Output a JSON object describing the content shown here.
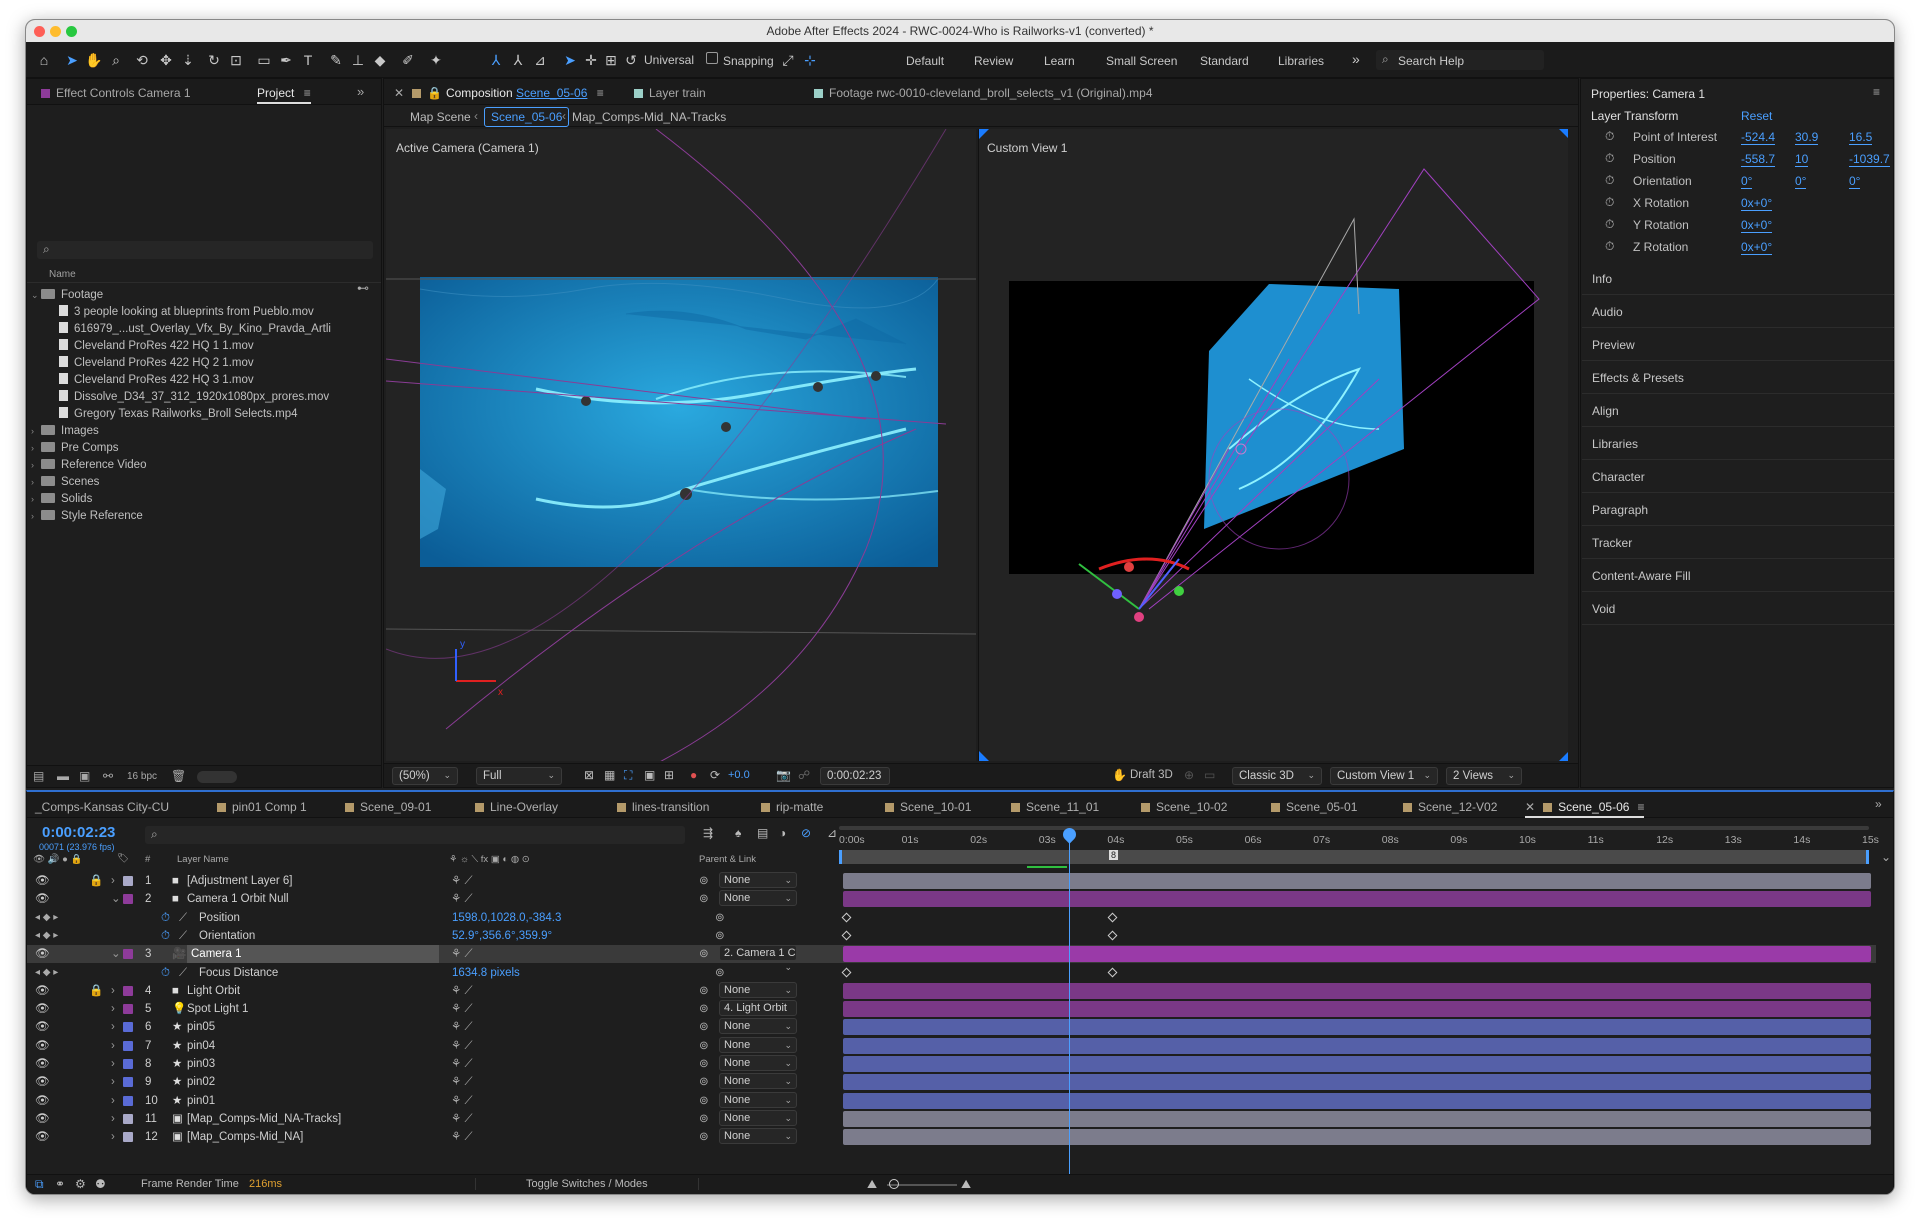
{
  "window": {
    "title": "Adobe After Effects 2024 - RWC-0024-Who is Railworks-v1 (converted) *"
  },
  "toolbar": {
    "universal_label": "Universal",
    "snapping_label": "Snapping",
    "workspaces": [
      "Default",
      "Review",
      "Learn",
      "Small Screen",
      "Standard",
      "Libraries"
    ],
    "search_placeholder": "Search Help"
  },
  "left_panel": {
    "tab_effect": "Effect Controls Camera 1",
    "tab_project": "Project",
    "name_header": "Name",
    "bpc": "16 bpc",
    "tree": [
      {
        "label": "Footage",
        "type": "folder",
        "open": true
      },
      {
        "label": "3 people looking at blueprints from Pueblo.mov",
        "type": "file"
      },
      {
        "label": "616979_...ust_Overlay_Vfx_By_Kino_Pravda_Artli",
        "type": "file"
      },
      {
        "label": "Cleveland ProRes 422 HQ 1 1.mov",
        "type": "file"
      },
      {
        "label": "Cleveland ProRes 422 HQ 2 1.mov",
        "type": "file"
      },
      {
        "label": "Cleveland ProRes 422 HQ 3 1.mov",
        "type": "file"
      },
      {
        "label": "Dissolve_D34_37_312_1920x1080px_prores.mov",
        "type": "file"
      },
      {
        "label": "Gregory Texas Railworks_Broll Selects.mp4",
        "type": "file"
      },
      {
        "label": "Images",
        "type": "folder"
      },
      {
        "label": "Pre Comps",
        "type": "folder"
      },
      {
        "label": "Reference Video",
        "type": "folder"
      },
      {
        "label": "Scenes",
        "type": "folder"
      },
      {
        "label": "Solids",
        "type": "folder"
      },
      {
        "label": "Style Reference",
        "type": "folder"
      }
    ]
  },
  "comp": {
    "tab_composition_prefix": "Composition",
    "tab_composition_name": "Scene_05-06",
    "tab_layer": "Layer train",
    "tab_footage": "Footage rwc-0010-cleveland_broll_selects_v1 (Original).mp4",
    "breadcrumbs": [
      "Map Scene",
      "Scene_05-06",
      "Map_Comps-Mid_NA-Tracks"
    ],
    "left_view_label": "Active Camera (Camera 1)",
    "right_view_label": "Custom View 1",
    "footer": {
      "zoom": "(50%)",
      "resolution": "Full",
      "exposure": "+0.0",
      "timecode": "0:00:02:23",
      "draft": "Draft 3D",
      "renderer": "Classic 3D",
      "view": "Custom View 1",
      "layout": "2 Views"
    }
  },
  "properties": {
    "title": "Properties: Camera 1",
    "section": "Layer Transform",
    "reset": "Reset",
    "rows": [
      {
        "name": "Point of Interest",
        "values": [
          "-524.4",
          "30.9",
          "16.5"
        ]
      },
      {
        "name": "Position",
        "values": [
          "-558.7",
          "10",
          "-1039.7"
        ]
      },
      {
        "name": "Orientation",
        "values": [
          "0°",
          "0°",
          "0°"
        ]
      },
      {
        "name": "X Rotation",
        "values": [
          "0x+0°"
        ]
      },
      {
        "name": "Y Rotation",
        "values": [
          "0x+0°"
        ]
      },
      {
        "name": "Z Rotation",
        "values": [
          "0x+0°"
        ]
      }
    ],
    "panels": [
      "Info",
      "Audio",
      "Preview",
      "Effects & Presets",
      "Align",
      "Libraries",
      "Character",
      "Paragraph",
      "Tracker",
      "Content-Aware Fill",
      "Void"
    ]
  },
  "timeline": {
    "tabs": [
      "_Comps-Kansas City-CU",
      "pin01 Comp 1",
      "Scene_09-01",
      "Line-Overlay",
      "lines-transition",
      "rip-matte",
      "Scene_10-01",
      "Scene_11_01",
      "Scene_10-02",
      "Scene_05-01",
      "Scene_12-V02",
      "Scene_05-06"
    ],
    "timecode": "0:00:02:23",
    "fps": "00071 (23.976 fps)",
    "layer_name_header": "Layer Name",
    "parent_header": "Parent & Link",
    "ticks": [
      "0:00s",
      "01s",
      "02s",
      "03s",
      "04s",
      "05s",
      "06s",
      "07s",
      "08s",
      "09s",
      "10s",
      "11s",
      "12s",
      "13s",
      "14s",
      "15s"
    ],
    "marker": "8",
    "rows": [
      {
        "num": "1",
        "name": "[Adjustment Layer 6]",
        "color": "#a9a9c8",
        "icon": "square",
        "parent": "None",
        "kind": "layer"
      },
      {
        "num": "2",
        "name": "Camera 1 Orbit Null",
        "color": "#8e3b9a",
        "icon": "square",
        "parent": "None",
        "kind": "layer",
        "open": true
      },
      {
        "name": "Position",
        "value": "1598.0,1028.0,-384.3",
        "kind": "prop"
      },
      {
        "name": "Orientation",
        "value": "52.9°,356.6°,359.9°",
        "kind": "prop"
      },
      {
        "num": "3",
        "name": "Camera 1",
        "color": "#8e3b9a",
        "icon": "camera",
        "parent": "2. Camera 1 C",
        "kind": "layer",
        "open": true,
        "selected": true
      },
      {
        "name": "Focus Distance",
        "value": "1634.8 pixels",
        "kind": "prop"
      },
      {
        "num": "4",
        "name": "Light Orbit",
        "color": "#8e3b9a",
        "icon": "square",
        "parent": "None",
        "kind": "layer"
      },
      {
        "num": "5",
        "name": "Spot Light 1",
        "color": "#8e3b9a",
        "icon": "light",
        "parent": "4. Light Orbit",
        "kind": "layer"
      },
      {
        "num": "6",
        "name": "pin05",
        "color": "#5a6bd6",
        "icon": "star",
        "parent": "None",
        "kind": "layer"
      },
      {
        "num": "7",
        "name": "pin04",
        "color": "#5a6bd6",
        "icon": "star",
        "parent": "None",
        "kind": "layer"
      },
      {
        "num": "8",
        "name": "pin03",
        "color": "#5a6bd6",
        "icon": "star",
        "parent": "None",
        "kind": "layer"
      },
      {
        "num": "9",
        "name": "pin02",
        "color": "#5a6bd6",
        "icon": "star",
        "parent": "None",
        "kind": "layer"
      },
      {
        "num": "10",
        "name": "pin01",
        "color": "#5a6bd6",
        "icon": "star",
        "parent": "None",
        "kind": "layer"
      },
      {
        "num": "11",
        "name": "[Map_Comps-Mid_NA-Tracks]",
        "color": "#a9a9c8",
        "icon": "comp",
        "parent": "None",
        "kind": "layer"
      },
      {
        "num": "12",
        "name": "[Map_Comps-Mid_NA]",
        "color": "#a9a9c8",
        "icon": "comp",
        "parent": "None",
        "kind": "layer"
      }
    ],
    "footer_render_label": "Frame Render Time",
    "footer_render_value": "216ms",
    "footer_toggle": "Toggle Switches / Modes"
  }
}
